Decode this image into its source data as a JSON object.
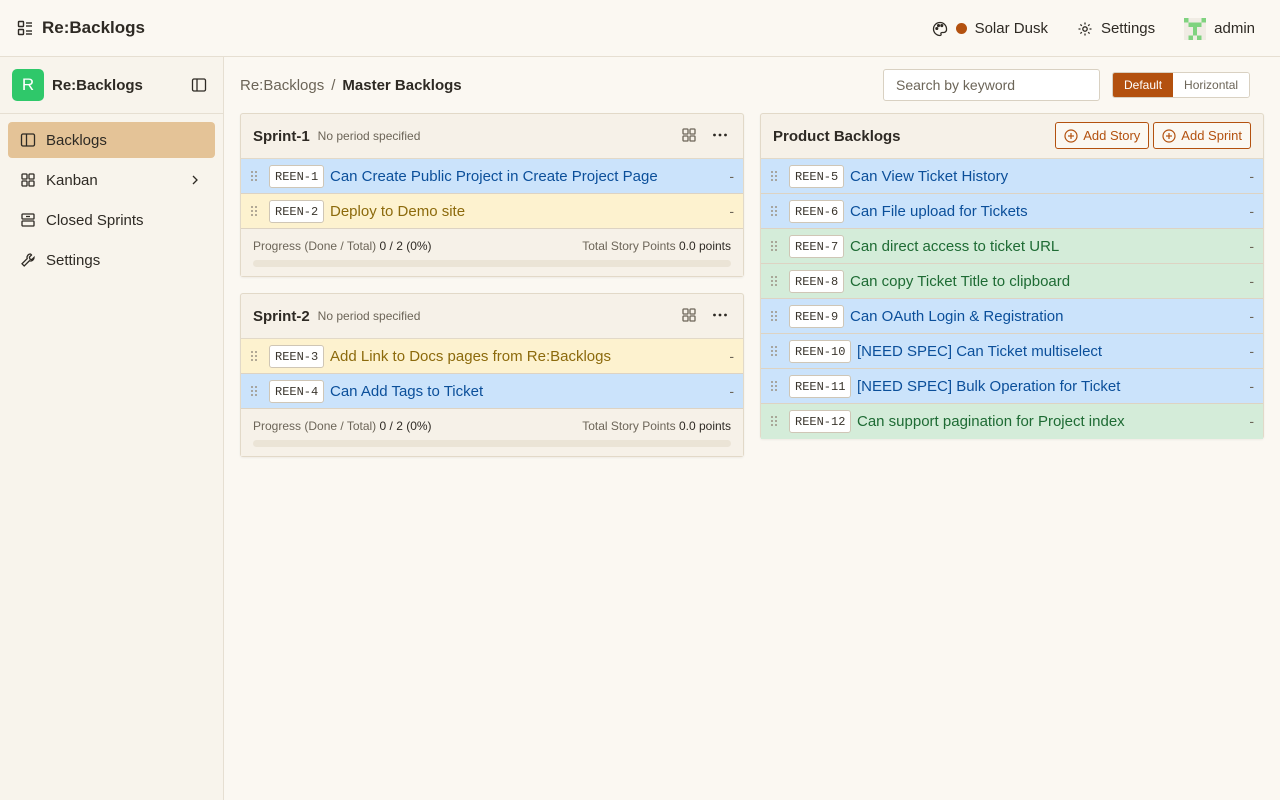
{
  "app": {
    "name": "Re:Backlogs"
  },
  "header": {
    "theme_label": "Solar Dusk",
    "settings_label": "Settings",
    "user_label": "admin"
  },
  "sidebar": {
    "project_initial": "R",
    "project_name": "Re:Backlogs",
    "items": [
      {
        "label": "Backlogs",
        "icon": "columns-icon",
        "active": true
      },
      {
        "label": "Kanban",
        "icon": "grid-icon"
      },
      {
        "label": "Closed Sprints",
        "icon": "archive-icon"
      },
      {
        "label": "Settings",
        "icon": "wrench-icon"
      }
    ]
  },
  "breadcrumb": {
    "root": "Re:Backlogs",
    "separator": "/",
    "current": "Master Backlogs"
  },
  "search": {
    "placeholder": "Search by keyword",
    "value": ""
  },
  "view_toggle": {
    "default_label": "Default",
    "horizontal_label": "Horizontal",
    "selected": "Default"
  },
  "colors": {
    "accent": "#b3510f",
    "blue_row": "#cbe3fb",
    "yellow_row": "#fdf2cf",
    "green_row": "#d4ecd9",
    "logo": "#2fc86a"
  },
  "sprints": [
    {
      "name": "Sprint-1",
      "period": "No period specified",
      "tickets": [
        {
          "key": "REEN-1",
          "title": "Can Create Public Project in Create Project Page",
          "points": "-",
          "status": "blue"
        },
        {
          "key": "REEN-2",
          "title": "Deploy to Demo site",
          "points": "-",
          "status": "yellow"
        }
      ],
      "progress_label": "Progress (Done / Total)",
      "progress_value": "0 / 2 (0%)",
      "progress_fraction": 0,
      "points_label": "Total Story Points",
      "points_value": "0.0 points"
    },
    {
      "name": "Sprint-2",
      "period": "No period specified",
      "tickets": [
        {
          "key": "REEN-3",
          "title": "Add Link to Docs pages from Re:Backlogs",
          "points": "-",
          "status": "yellow"
        },
        {
          "key": "REEN-4",
          "title": "Can Add Tags to Ticket",
          "points": "-",
          "status": "blue"
        }
      ],
      "progress_label": "Progress (Done / Total)",
      "progress_value": "0 / 2 (0%)",
      "progress_fraction": 0,
      "points_label": "Total Story Points",
      "points_value": "0.0 points"
    }
  ],
  "product_backlog": {
    "title": "Product Backlogs",
    "add_story_label": "Add Story",
    "add_sprint_label": "Add Sprint",
    "tickets": [
      {
        "key": "REEN-5",
        "title": "Can View Ticket History",
        "points": "-",
        "status": "blue"
      },
      {
        "key": "REEN-6",
        "title": "Can File upload for Tickets",
        "points": "-",
        "status": "blue"
      },
      {
        "key": "REEN-7",
        "title": "Can direct access to ticket URL",
        "points": "-",
        "status": "green"
      },
      {
        "key": "REEN-8",
        "title": "Can copy Ticket Title to clipboard",
        "points": "-",
        "status": "green"
      },
      {
        "key": "REEN-9",
        "title": "Can OAuth Login & Registration",
        "points": "-",
        "status": "blue"
      },
      {
        "key": "REEN-10",
        "title": "[NEED SPEC] Can Ticket multiselect",
        "points": "-",
        "status": "blue"
      },
      {
        "key": "REEN-11",
        "title": "[NEED SPEC] Bulk Operation for Ticket",
        "points": "-",
        "status": "blue"
      },
      {
        "key": "REEN-12",
        "title": "Can support pagination for Project index",
        "points": "-",
        "status": "green"
      }
    ]
  }
}
